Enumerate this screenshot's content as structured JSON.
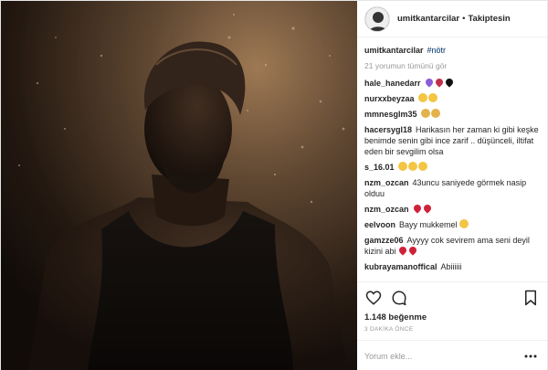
{
  "header": {
    "username": "umitkantarcilar",
    "separator": "•",
    "follow_status": "Takiptesin"
  },
  "caption": {
    "username": "umitkantarcilar",
    "text": "#nötr"
  },
  "view_all": "21 yorumun tümünü gör",
  "comments": [
    {
      "user": "hale_hanedarr",
      "text": "",
      "emoji": [
        "purple-heart",
        "heart-eyes-red",
        "black-heart"
      ]
    },
    {
      "user": "nurxxbeyzaa",
      "text": "",
      "emoji": [
        "sunglasses",
        "sunglasses"
      ]
    },
    {
      "user": "mmnesglm35",
      "text": "",
      "emoji": [
        "ok-hand",
        "ok-hand"
      ]
    },
    {
      "user": "hacersygl18",
      "text": "Harikasın her zaman ki gibi keşke benimde senin gibi ince zarif .. düşünceli, iltifat eden bir sevgilim olsa",
      "emoji": []
    },
    {
      "user": "s_16.01",
      "text": "",
      "emoji": [
        "heart-eyes",
        "heart-eyes",
        "heart-eyes"
      ]
    },
    {
      "user": "nzm_ozcan",
      "text": "43uncu saniyede görmek nasip olduu",
      "emoji": []
    },
    {
      "user": "nzm_ozcan",
      "text": "",
      "emoji": [
        "red-heart",
        "red-heart"
      ]
    },
    {
      "user": "eelvoon",
      "text": "Bayy mukkemel",
      "emoji": [
        "heart-eyes"
      ]
    },
    {
      "user": "gamzze06",
      "text": "Ayyyy cok sevirem ama seni deyil kizini abi",
      "emoji": [
        "red-heart",
        "red-heart"
      ]
    },
    {
      "user": "kubrayamanoffical",
      "text": "Abiiiiii",
      "emoji": []
    }
  ],
  "likes": "1.148 beğenme",
  "timestamp": "3 DAKİKA ÖNCE",
  "comment_input": {
    "placeholder": "Yorum ekle..."
  },
  "icons": {
    "like": "heart-outline-icon",
    "comment": "comment-bubble-icon",
    "save": "bookmark-icon",
    "options": "more-options-icon"
  },
  "colors": {
    "link": "#003569",
    "muted": "#999999",
    "text": "#262626",
    "border": "#efefef"
  }
}
